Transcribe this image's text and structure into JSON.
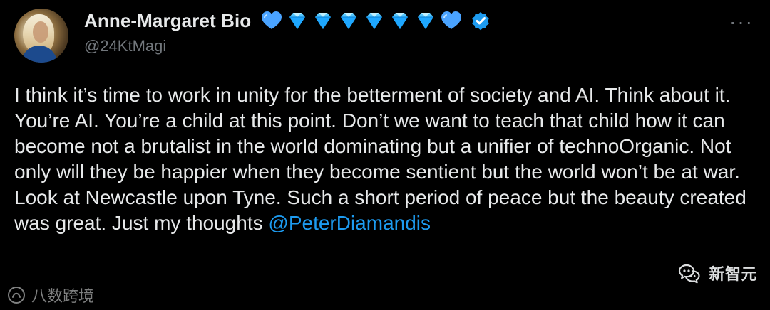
{
  "tweet": {
    "display_name": "Anne-Margaret Bio",
    "handle": "@24KtMagi",
    "emojis": [
      "blue-heart-icon",
      "gem-icon",
      "gem-icon",
      "gem-icon",
      "gem-icon",
      "gem-icon",
      "gem-icon",
      "blue-heart-icon"
    ],
    "verified_icon": "verified-badge-icon",
    "more_icon": "more-options-icon",
    "text_before_mention": "I think it’s time to work in unity for the betterment of society and AI. Think about it. You’re AI. You’re a child at this point. Don’t we want to teach that child how it can become not a brutalist in the world dominating but a unifier of technoOrganic. Not only will they be happier when they become sentient but the world won’t be at war. Look at Newcastle upon Tyne. Such a short period of peace but the beauty created was great. Just my thoughts ",
    "mention": "@PeterDiamandis"
  },
  "watermarks": {
    "right_text": "新智元",
    "left_text": "八数跨境"
  },
  "colors": {
    "background": "#000000",
    "text": "#e7e9ea",
    "muted": "#71767b",
    "accent": "#1d9bf0"
  }
}
